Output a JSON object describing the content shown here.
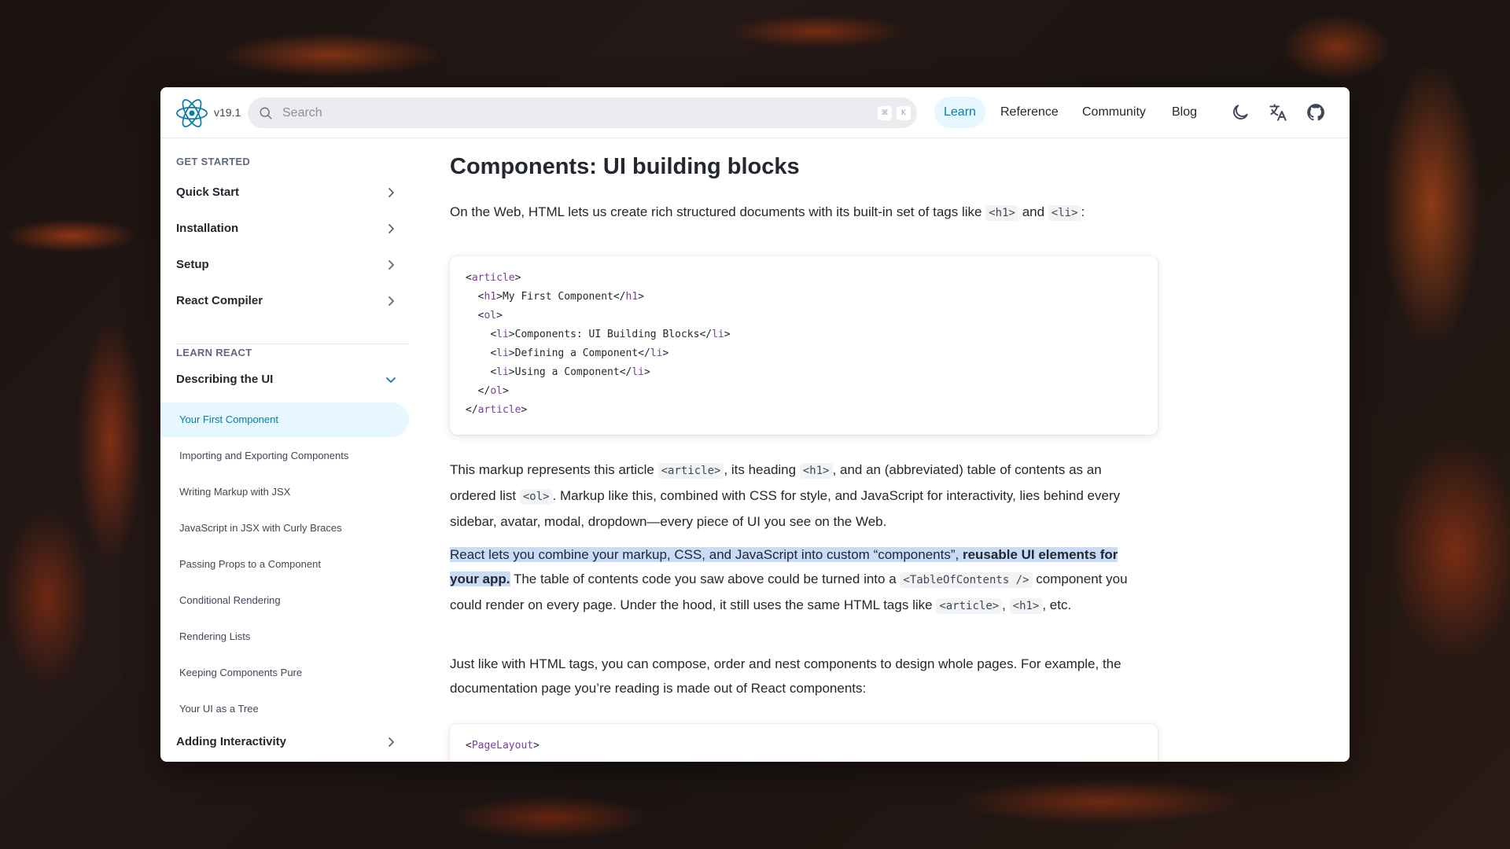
{
  "header": {
    "version": "v19.1",
    "search_placeholder": "Search",
    "kbd_cmd": "⌘",
    "kbd_k": "K",
    "nav": [
      "Learn",
      "Reference",
      "Community",
      "Blog"
    ]
  },
  "sidebar": {
    "get_started": "GET STARTED",
    "items": [
      "Quick Start",
      "Installation",
      "Setup",
      "React Compiler"
    ],
    "learn_react": "LEARN REACT",
    "describing": "Describing the UI",
    "subitems": [
      "Your First Component",
      "Importing and Exporting Components",
      "Writing Markup with JSX",
      "JavaScript in JSX with Curly Braces",
      "Passing Props to a Component",
      "Conditional Rendering",
      "Rendering Lists",
      "Keeping Components Pure",
      "Your UI as a Tree"
    ],
    "adding_interactivity": "Adding Interactivity"
  },
  "content": {
    "title": "Components: UI building blocks",
    "intro_text": "On the Web, HTML lets us create rich structured documents with its built-in set of tags like",
    "intro_code1": "<h1>",
    "intro_and": "and",
    "intro_code2": "<li>",
    "intro_end": ":",
    "code1": [
      "<article>",
      "  <h1>My First Component</h1>",
      "  <ol>",
      "    <li>Components: UI Building Blocks</li>",
      "    <li>Defining a Component</li>",
      "    <li>Using a Component</li>",
      "  </ol>",
      "</article>"
    ],
    "p2": {
      "a": "This markup represents this article",
      "c1": "<article>",
      "b": ", its heading",
      "c2": "<h1>",
      "c": ", and an (abbreviated) table of contents as an ordered list",
      "c3": "<ol>",
      "d": ". Markup like this, combined with CSS for style, and JavaScript for interactivity, lies behind every sidebar, avatar, modal, dropdown—every piece of UI you see on the Web."
    },
    "p3": {
      "hl_normal": "React lets you combine your markup, CSS, and JavaScript into custom “components”,",
      "hl_bold": "reusable UI elements for your app.",
      "a": "The table of contents code you saw above could be turned into a",
      "c1": "<TableOfContents />",
      "b": "component you could render on every page. Under the hood, it still uses the same HTML tags like",
      "c2": "<article>",
      "c": ",",
      "c3": "<h1>",
      "d": ", etc."
    },
    "p4": "Just like with HTML tags, you can compose, order and nest components to design whole pages. For example, the documentation page you’re reading is made out of React components:",
    "code2_first": "<PageLayout>"
  }
}
